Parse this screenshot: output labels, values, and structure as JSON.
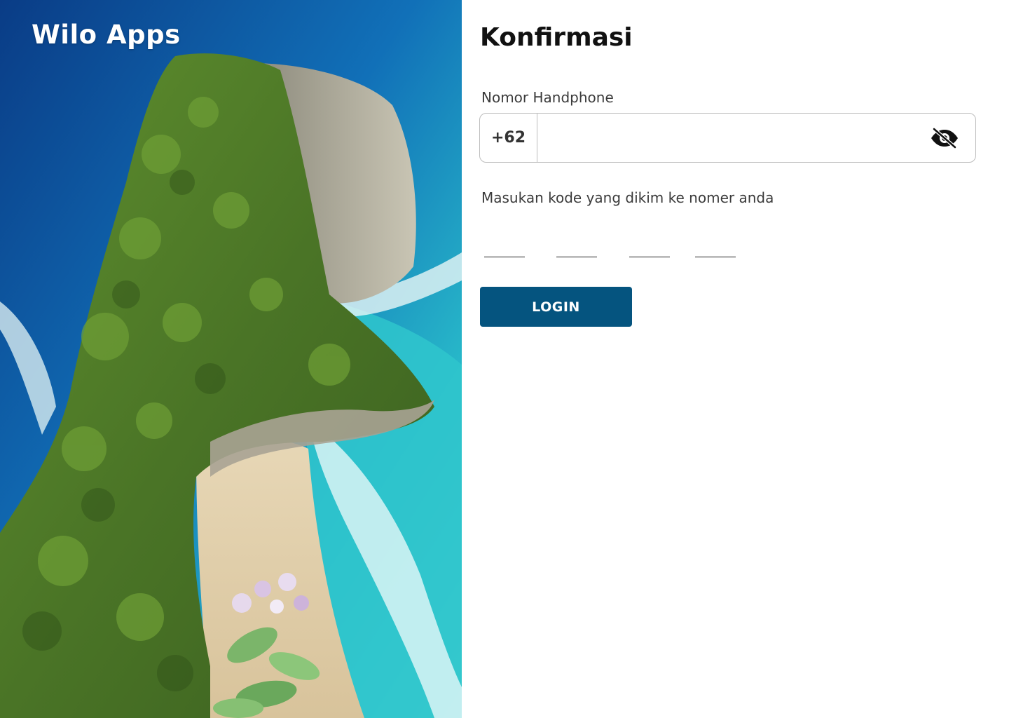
{
  "brand": {
    "name": "Wilo Apps"
  },
  "hero": {
    "image_subject": "aerial photo of a coastal cliff headland with turquoise sea and sandy beach"
  },
  "form": {
    "title": "Konfirmasi",
    "phone_label": "Nomor Handphone",
    "country_code": "+62",
    "phone_value": "",
    "toggle_icon": "eye-slash-icon",
    "code_label": "Masukan kode yang dikim ke nomer anda",
    "otp_digits": [
      "",
      "",
      "",
      ""
    ],
    "login_label": "LOGIN"
  },
  "colors": {
    "primary": "#05547f",
    "title_text": "#111111",
    "label_text": "#3a3a3a",
    "field_border": "#bdbdbd"
  }
}
